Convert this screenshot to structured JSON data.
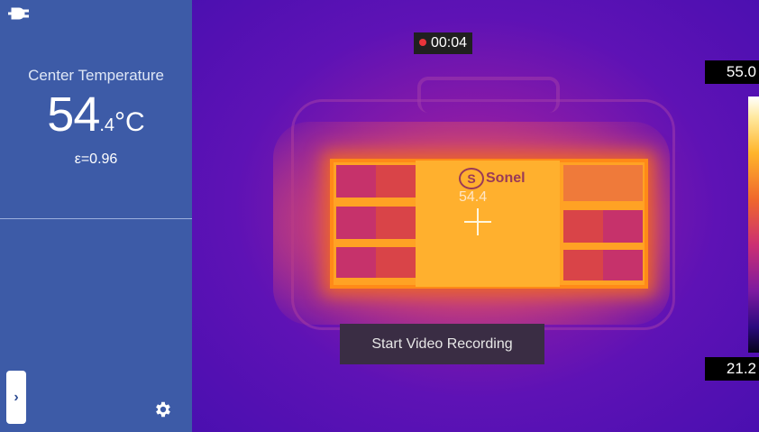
{
  "sidebar": {
    "title": "Center Temperature",
    "temp_int": "54",
    "temp_dec": ".4",
    "temp_unit": "°C",
    "emissivity": "ε=0.96",
    "expand_glyph": "›",
    "icons": {
      "power": "plug-icon",
      "settings": "gear-icon"
    },
    "colors": {
      "background": "#3d5ba7"
    }
  },
  "viewer": {
    "timer": "00:04",
    "spot_label": "54.4",
    "logo_text": "Sonel",
    "logo_ring_letter": "S",
    "scale_max": "55.0",
    "scale_min": "21.2",
    "toast": "Start Video Recording",
    "recording_color": "#e8343a"
  }
}
